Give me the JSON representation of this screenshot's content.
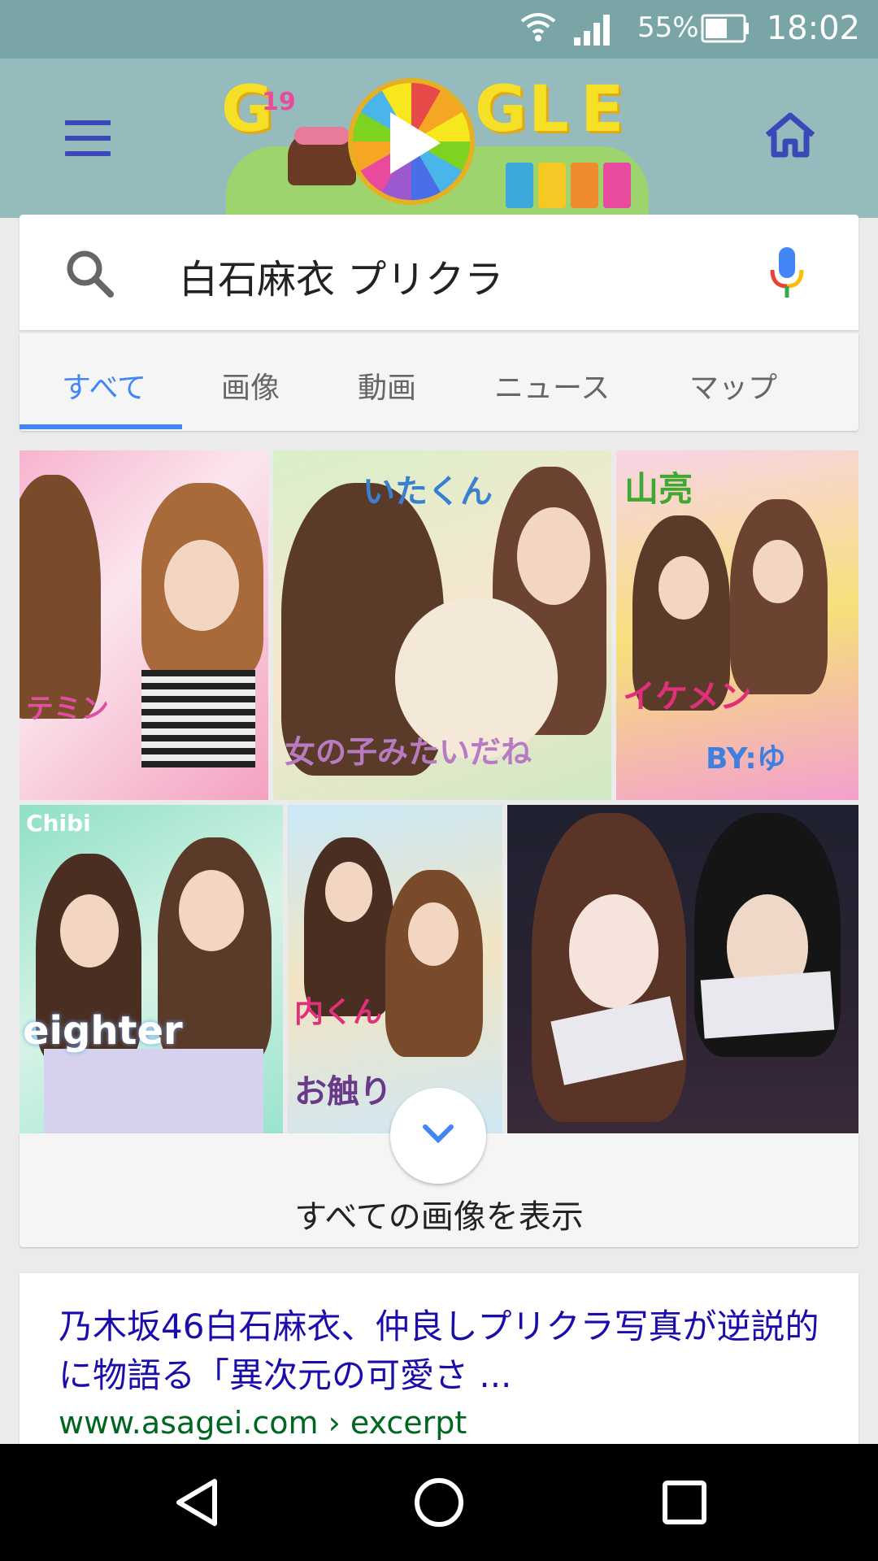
{
  "status_bar": {
    "battery_percent": "55%",
    "time": "18:02"
  },
  "doodle": {
    "letters": [
      "G",
      "G",
      "L",
      "E"
    ],
    "candle_number": "19"
  },
  "search": {
    "query": "白石麻衣 プリクラ"
  },
  "tabs": [
    {
      "label": "すべて",
      "active": true
    },
    {
      "label": "画像",
      "active": false
    },
    {
      "label": "動画",
      "active": false
    },
    {
      "label": "ニュース",
      "active": false
    },
    {
      "label": "マップ",
      "active": false
    }
  ],
  "images": {
    "scribbles": [
      "テミン",
      "いたくん",
      "女の子みたいだね",
      "山亮",
      "イケメン",
      "BY:ゆ",
      "Chibi",
      "eighter",
      "内くん",
      "お触り"
    ]
  },
  "show_all_label": "すべての画像を表示",
  "result": {
    "title": "乃木坂46白石麻衣、仲良しプリクラ写真が逆説的に物語る「異次元の可愛さ ...",
    "url": "www.asagei.com › excerpt"
  },
  "colors": {
    "status_bar": "#7aa5a7",
    "header": "#95bbbd",
    "link": "#1a0dab",
    "url": "#006621",
    "accent": "#4285f4"
  }
}
